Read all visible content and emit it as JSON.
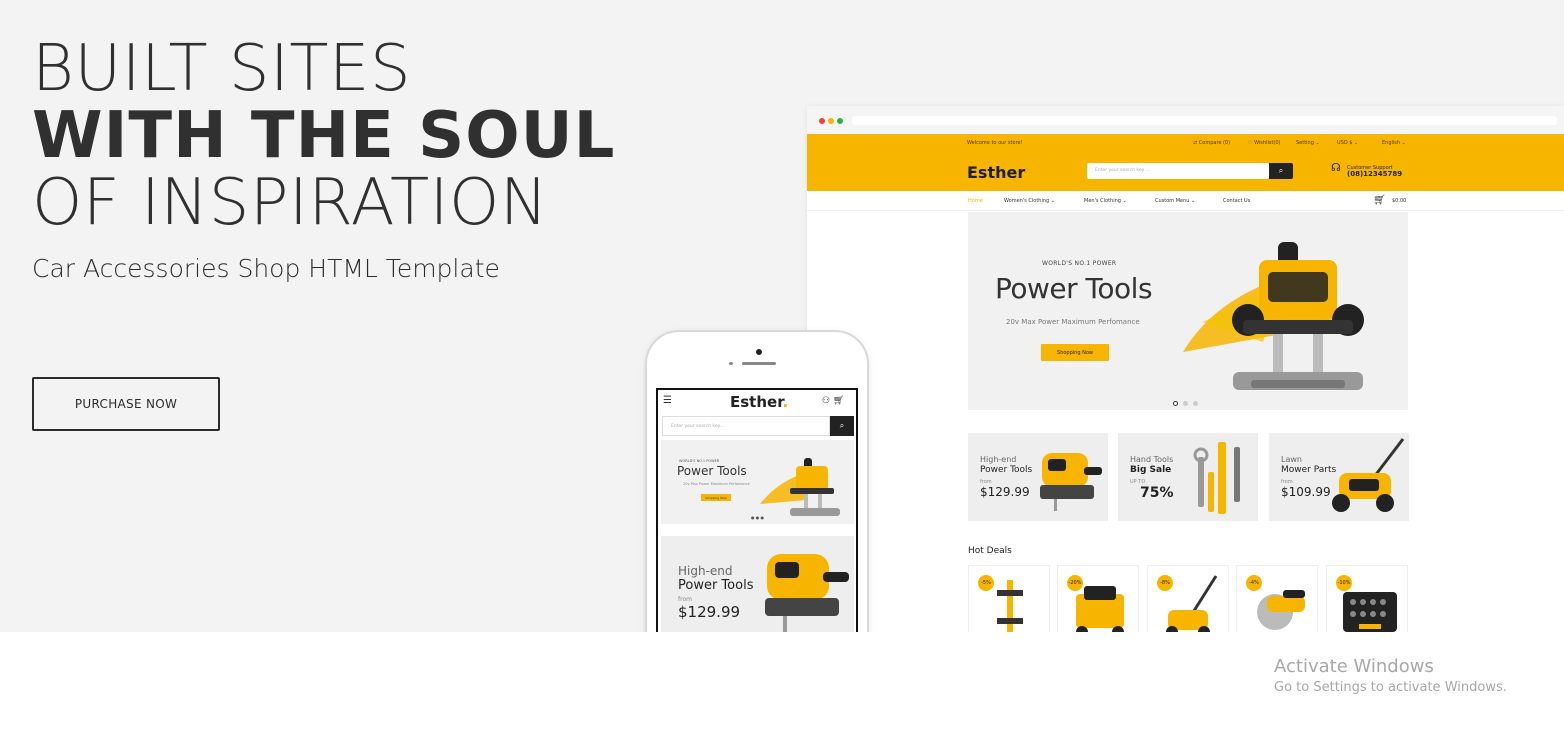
{
  "hero": {
    "line1": "BUILT SITES",
    "line2": "WITH THE SOUL",
    "line3": "OF INSPIRATION",
    "subtitle": "Car Accessories Shop HTML Template",
    "purchase_label": "PURCHASE NOW"
  },
  "colors": {
    "accent": "#f7b500",
    "background": "#f3f3f3",
    "dark": "#222222"
  },
  "desktop": {
    "topbar": {
      "welcome": "Welcome to our store!",
      "compare": "⇄ Compare (0)",
      "wishlist": "♡ Wishlist(0)",
      "setting": "Setting ⌄",
      "currency": "USD $ ⌄",
      "language": "English ⌄"
    },
    "logo": "Esther",
    "search_placeholder": "Enter your search key ...",
    "support_label": "Customer Support",
    "support_phone": "(08)12345789",
    "nav": [
      "Home",
      "Women's Clothing ⌄",
      "Men's Clothing ⌄",
      "Custom Menu ⌄",
      "Contact Us"
    ],
    "cart_total": "$0.00",
    "slider": {
      "kicker": "WORLD'S NO.1 POWER",
      "title": "Power Tools",
      "description": "20v Max Power Maximum Perfomance",
      "button": "Shopping Now"
    },
    "banners": [
      {
        "line1": "High-end",
        "line2": "Power Tools",
        "line3": "from",
        "price": "$129.99"
      },
      {
        "line1": "Hand Tools",
        "line2": "Big Sale",
        "line3": "UP TO",
        "price": "75%"
      },
      {
        "line1": "Lawn",
        "line2": "Mower Parts",
        "line3": "from",
        "price": "$109.99"
      }
    ],
    "hot_deals_title": "Hot Deals",
    "deals": [
      {
        "discount": "-5%"
      },
      {
        "discount": "-20%"
      },
      {
        "discount": "-8%"
      },
      {
        "discount": "-4%"
      },
      {
        "discount": "-10%"
      }
    ]
  },
  "mobile": {
    "logo": "Esther",
    "logo_dot": ".",
    "search_placeholder": "Enter your search key...",
    "slider": {
      "kicker": "WORLD'S NO.1 POWER",
      "title": "Power Tools",
      "description": "20v Max Power Maximum Perfomance",
      "button": "Shopping Now"
    },
    "banner": {
      "line1": "High-end",
      "line2": "Power Tools",
      "line3": "from",
      "price": "$129.99"
    }
  },
  "windows": {
    "title": "Activate Windows",
    "message": "Go to Settings to activate Windows."
  }
}
